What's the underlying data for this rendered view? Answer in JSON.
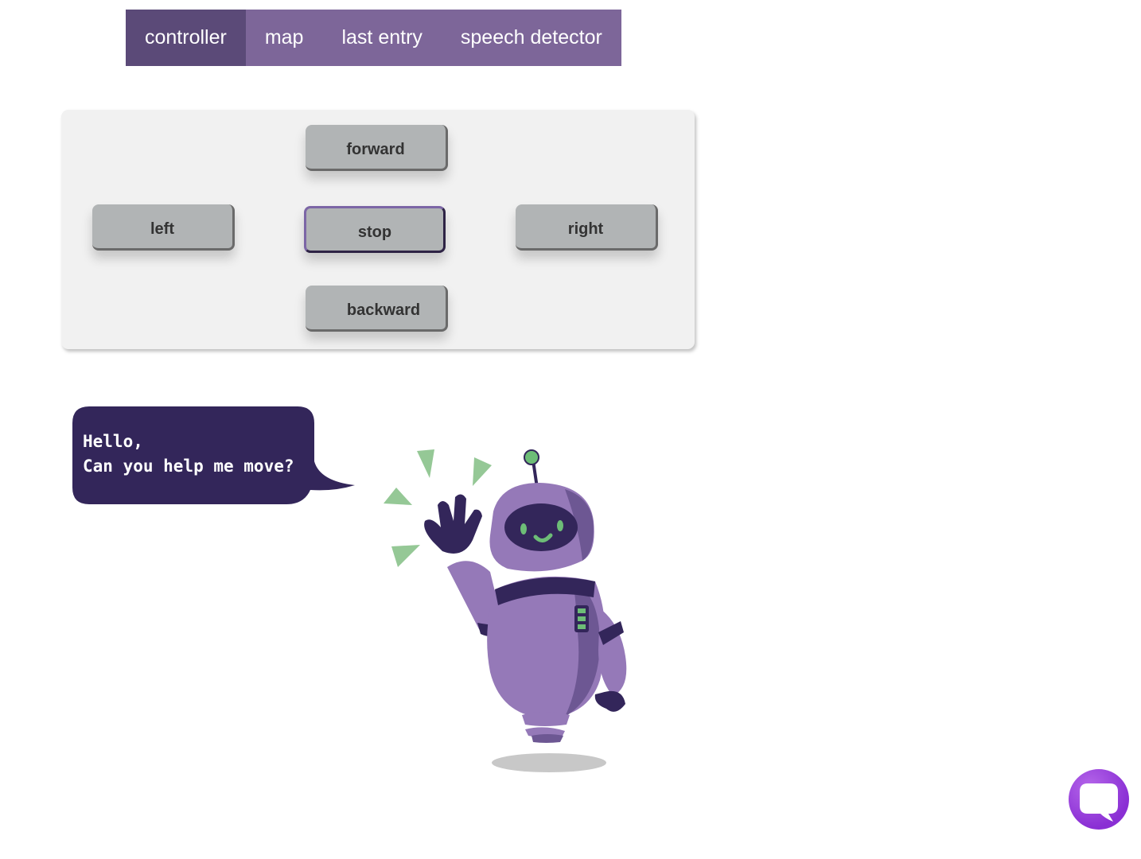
{
  "nav": {
    "tabs": [
      {
        "label": "controller",
        "active": true
      },
      {
        "label": "map",
        "active": false
      },
      {
        "label": "last entry",
        "active": false
      },
      {
        "label": "speech detector",
        "active": false
      }
    ]
  },
  "controls": {
    "forward": "forward",
    "left": "left",
    "stop": "stop",
    "right": "right",
    "backward": "backward"
  },
  "bubble": {
    "text": "Hello,\nCan you help me move?"
  },
  "colors": {
    "tab_bar": "#7d6699",
    "tab_active": "#5b4a78",
    "button": "#b1b4b5",
    "bubble": "#33265a",
    "robot_body": "#9579b8",
    "chat_button": "#8a2fd4"
  },
  "icons": {
    "chat": "chat-bubble-icon"
  }
}
